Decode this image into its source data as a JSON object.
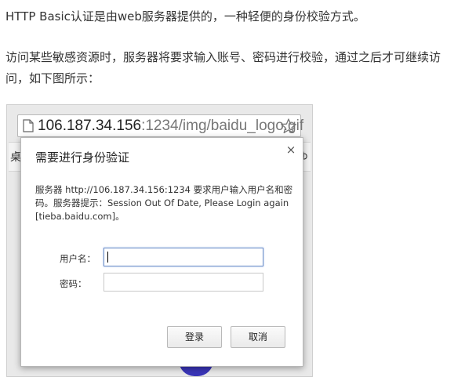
{
  "article": {
    "paragraph1": "HTTP Basic认证是由web服务器提供的，一种轻便的身份校验方式。",
    "paragraph2": "访问某些敏感资源时，服务器将要求输入账号、密码进行校验，通过之后才可继续访问，如下图所示："
  },
  "browser": {
    "url_host": "106.187.34.156",
    "url_rest": ":1234/img/baidu_logo.gif",
    "bg_left_text": "桌",
    "bg_right_text": "ゆ"
  },
  "auth_dialog": {
    "title": "需要进行身份验证",
    "close_label": "×",
    "message": "服务器 http://106.187.34.156:1234 要求用户输入用户名和密码。服务器提示：Session Out Of Date, Please Login again [tieba.baidu.com]。",
    "username_label": "用户名：",
    "password_label": "密码：",
    "username_value": "",
    "password_value": "",
    "login_button": "登录",
    "cancel_button": "取消"
  }
}
